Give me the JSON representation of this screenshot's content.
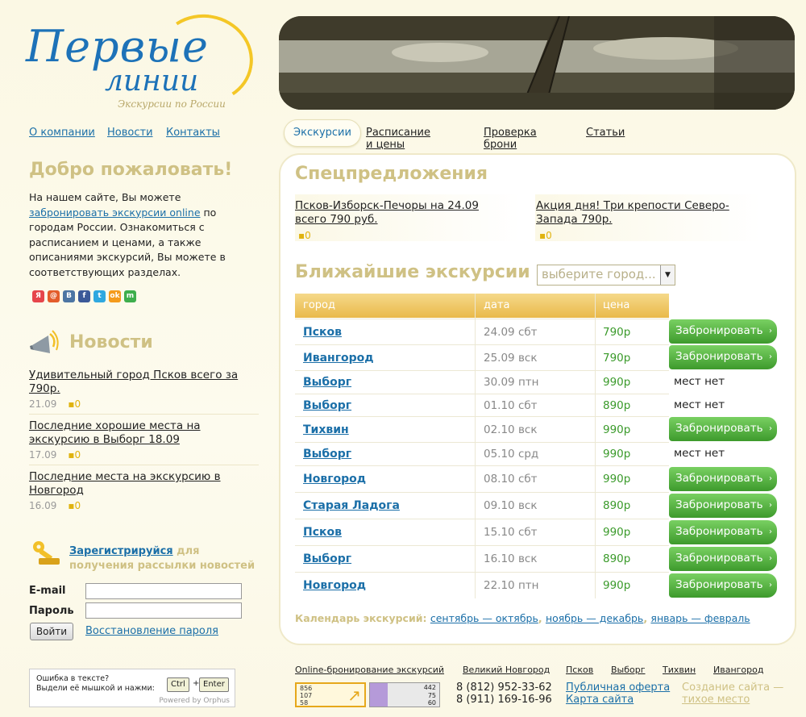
{
  "logo": {
    "line1": "Первые",
    "line2": "линии",
    "tagline": "Экскурсии по России"
  },
  "topnav": [
    "О компании",
    "Новости",
    "Контакты"
  ],
  "tabs": [
    "Экскурсии",
    "Расписание и цены",
    "Проверка брони",
    "Статьи"
  ],
  "welcome": {
    "title": "Добро пожаловать!",
    "text_before": "На нашем сайте, Вы можете ",
    "link": "забронировать экскурсии online",
    "text_after": " по городам России. Ознакомиться с расписанием и ценами, а также описаниями экскурсий, Вы можете в соответствующих разделах."
  },
  "social": [
    {
      "icon": "ya-icon",
      "glyph": "Я",
      "color": "#e6454b"
    },
    {
      "icon": "mail-ru-icon",
      "glyph": "@",
      "color": "#e35c2b"
    },
    {
      "icon": "vkontakte-icon",
      "glyph": "B",
      "color": "#4c75a3"
    },
    {
      "icon": "facebook-icon",
      "glyph": "f",
      "color": "#3b5998"
    },
    {
      "icon": "twitter-icon",
      "glyph": "t",
      "color": "#2fa8e0"
    },
    {
      "icon": "odnoklassniki-icon",
      "glyph": "ok",
      "color": "#f49b1c"
    },
    {
      "icon": "myworld-icon",
      "glyph": "m",
      "color": "#3eae4c"
    }
  ],
  "news": {
    "title": "Новости",
    "items": [
      {
        "title": "Удивительный город Псков всего за 790р.",
        "date": "21.09",
        "comments": "0"
      },
      {
        "title": "Последние хорошие места на экскурсию в Выборг 18.09",
        "date": "17.09",
        "comments": "0"
      },
      {
        "title": "Последние места на экскурсию в Новгород",
        "date": "16.09",
        "comments": "0"
      }
    ]
  },
  "register": {
    "link": "Зарегистрируйся",
    "text": " для получения рассылки новостей",
    "email_label": "E-mail",
    "password_label": "Пароль",
    "email_value": "",
    "password_value": "",
    "login_button": "Войти",
    "restore_link": "Восстановление пароля"
  },
  "orphus": {
    "line1": "Ошибка в тексте?",
    "line2": "Выдели её мышкой и нажми:",
    "key1": "Ctrl",
    "plus": "+",
    "key2": "Enter",
    "powered": "Powered by Orphus"
  },
  "special": {
    "title": "Спецпредложения",
    "items": [
      {
        "title": "Псков-Изборск-Печоры на 24.09 всего 790 руб.",
        "comments": "0"
      },
      {
        "title": "Акция дня! Три крепости Северо-Запада 790р.",
        "comments": "0"
      }
    ]
  },
  "nearest": {
    "title": "Ближайшие экскурсии",
    "select_placeholder": "выберите город...",
    "headers": [
      "город",
      "дата",
      "цена"
    ],
    "book_label": "Забронировать",
    "no_seats": "мест нет",
    "rows": [
      {
        "city": "Псков",
        "date": "24.09 сбт",
        "price": "790р",
        "available": true
      },
      {
        "city": "Ивангород",
        "date": "25.09 вск",
        "price": "790р",
        "available": true
      },
      {
        "city": "Выборг",
        "date": "30.09 птн",
        "price": "990р",
        "available": false
      },
      {
        "city": "Выборг",
        "date": "01.10 сбт",
        "price": "890р",
        "available": false
      },
      {
        "city": "Тихвин",
        "date": "02.10 вск",
        "price": "990р",
        "available": true
      },
      {
        "city": "Выборг",
        "date": "05.10 срд",
        "price": "990р",
        "available": false
      },
      {
        "city": "Новгород",
        "date": "08.10 сбт",
        "price": "990р",
        "available": true
      },
      {
        "city": "Старая Ладога",
        "date": "09.10 вск",
        "price": "890р",
        "available": true
      },
      {
        "city": "Псков",
        "date": "15.10 сбт",
        "price": "990р",
        "available": true
      },
      {
        "city": "Выборг",
        "date": "16.10 вск",
        "price": "890р",
        "available": true
      },
      {
        "city": "Новгород",
        "date": "22.10 птн",
        "price": "990р",
        "available": true
      }
    ]
  },
  "calendar": {
    "label": "Календарь экскурсий:",
    "links": [
      "сентябрь — октябрь",
      "ноябрь — декабрь",
      "январь — февраль"
    ]
  },
  "footer": {
    "links": [
      "Online-бронирование экскурсий",
      "Великий Новгород",
      "Псков",
      "Выборг",
      "Тихвин",
      "Ивангород"
    ],
    "counter1": [
      "856",
      "107",
      "58"
    ],
    "counter2": [
      "442",
      "75",
      "60"
    ],
    "phones": [
      "8 (812) 952-33-62",
      "8 (911) 169-16-96"
    ],
    "offer": "Публичная оферта",
    "sitemap": "Карта сайта",
    "creator_text": "Создание сайта —",
    "creator_link": "тихое место"
  },
  "colors": {
    "accent": "#cfc184",
    "link": "#1b6fa8",
    "book_green": "#4caf38",
    "price_green": "#3a9a2a",
    "header_orange": "#e9b94a"
  }
}
